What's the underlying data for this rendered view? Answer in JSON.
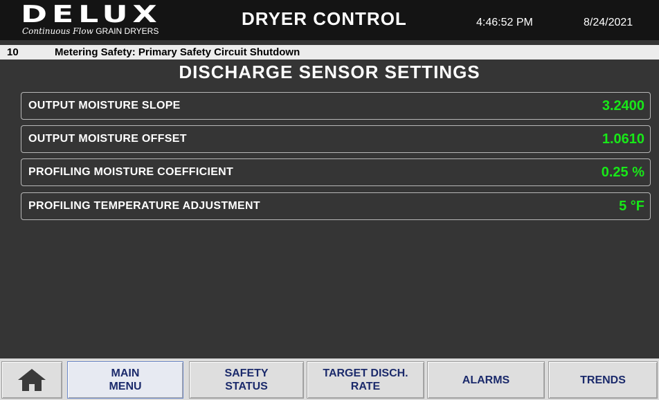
{
  "header": {
    "logo_word": "DELUX",
    "logo_tag_script": "Continuous Flow",
    "logo_tag_caps": "GRAIN DRYERS",
    "title": "DRYER CONTROL",
    "time": "4:46:52 PM",
    "date": "8/24/2021"
  },
  "alarm": {
    "code": "10",
    "message": "Metering Safety: Primary Safety Circuit Shutdown"
  },
  "page_title": "DISCHARGE SENSOR SETTINGS",
  "settings": [
    {
      "label": "OUTPUT MOISTURE SLOPE",
      "value": "3.2400"
    },
    {
      "label": "OUTPUT MOISTURE OFFSET",
      "value": "1.0610"
    },
    {
      "label": "PROFILING MOISTURE COEFFICIENT",
      "value": "0.25 %"
    },
    {
      "label": "PROFILING TEMPERATURE ADJUSTMENT",
      "value": "5 °F"
    }
  ],
  "nav": {
    "home_icon": "home-icon",
    "main_menu": "MAIN\nMENU",
    "safety_status": "SAFETY\nSTATUS",
    "target_discharge_rate": "TARGET DISCH.\nRATE",
    "alarms": "ALARMS",
    "trends": "TRENDS"
  },
  "colors": {
    "background": "#353535",
    "header": "#141414",
    "value_green": "#18e818",
    "nav_text": "#1b2a6b"
  }
}
